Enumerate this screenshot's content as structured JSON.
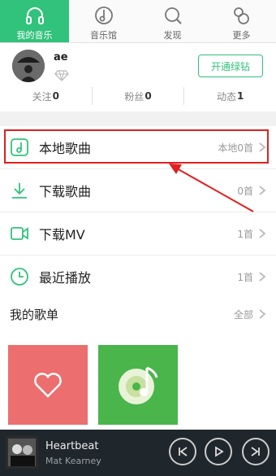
{
  "tabs": [
    {
      "label": "我的音乐",
      "icon": "headphones-icon",
      "active": true
    },
    {
      "label": "音乐馆",
      "icon": "music-note-icon",
      "active": false
    },
    {
      "label": "发现",
      "icon": "search-icon",
      "active": false
    },
    {
      "label": "更多",
      "icon": "more-icon",
      "active": false
    }
  ],
  "profile": {
    "username": "ae",
    "vip_button": "开通绿钻",
    "stats": [
      {
        "label": "关注",
        "value": "0"
      },
      {
        "label": "粉丝",
        "value": "0"
      },
      {
        "label": "动态",
        "value": "1"
      }
    ]
  },
  "menu": [
    {
      "label": "本地歌曲",
      "count": "本地0首",
      "icon": "local-music-icon"
    },
    {
      "label": "下载歌曲",
      "count": "0首",
      "icon": "download-icon"
    },
    {
      "label": "下载MV",
      "count": "1首",
      "icon": "video-icon"
    },
    {
      "label": "最近播放",
      "count": "1首",
      "icon": "clock-icon"
    }
  ],
  "songlists": {
    "title": "我的歌单",
    "all_label": "全部"
  },
  "player": {
    "title": "Heartbeat",
    "artist": "Mat Kearney"
  },
  "colors": {
    "accent": "#31c27c",
    "annotation": "#e02020"
  }
}
